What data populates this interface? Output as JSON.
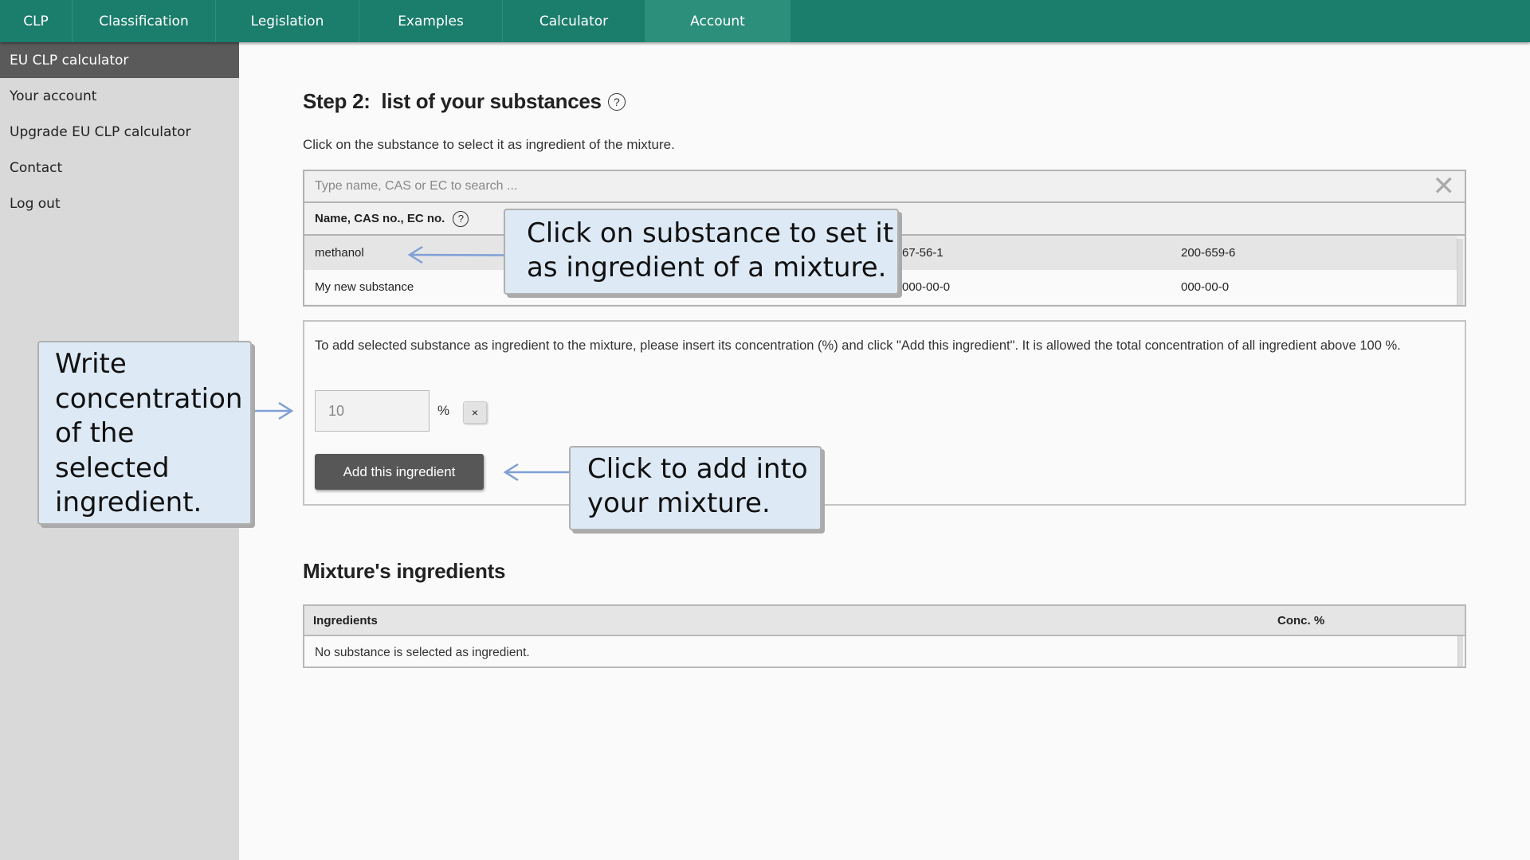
{
  "nav": {
    "items": [
      {
        "label": "CLP",
        "active": false
      },
      {
        "label": "Classification",
        "active": false
      },
      {
        "label": "Legislation",
        "active": false
      },
      {
        "label": "Examples",
        "active": false
      },
      {
        "label": "Calculator",
        "active": false
      },
      {
        "label": "Account",
        "active": true
      }
    ]
  },
  "sidebar": {
    "items": [
      {
        "label": "EU CLP calculator",
        "active": true
      },
      {
        "label": "Your account"
      },
      {
        "label": "Upgrade EU CLP calculator"
      },
      {
        "label": "Contact"
      },
      {
        "label": "Log out"
      }
    ]
  },
  "main": {
    "step_title": "Step 2:  list of your substances",
    "help_glyph": "?",
    "instruction": "Click on the substance to select it as ingredient of the mixture.",
    "search": {
      "placeholder": "Type name, CAS or EC to search ...",
      "value": "",
      "clear_glyph": "✕"
    },
    "substances_table": {
      "header": "Name, CAS no., EC no.",
      "rows": [
        {
          "name": "methanol",
          "cas": "67-56-1",
          "ec": "200-659-6",
          "selected": true
        },
        {
          "name": "My new substance",
          "cas": "000-00-0",
          "ec": "000-00-0",
          "selected": false
        }
      ]
    },
    "concentration": {
      "text": "To add selected substance as ingredient to the mixture, please insert its concentration (%) and click \"Add this ingredient\". It is allowed the total concentration of all ingredient above 100 %.",
      "input_value": "10",
      "unit": "%",
      "clear_glyph": "×",
      "add_button": "Add this ingredient"
    },
    "mixture": {
      "title": "Mixture's ingredients",
      "columns": [
        "Ingredients",
        "Conc. %"
      ],
      "empty_text": "No substance is selected as ingredient."
    }
  },
  "callouts": {
    "select_substance": "Click on substance to set it as ingredient of a mixture.",
    "write_concentration": "Write concentration of the selected ingredient.",
    "add_ingredient": "Click to add into your mixture."
  },
  "colors": {
    "nav_bg": "#1b7d6c",
    "nav_active": "#2c8f7b",
    "sidebar_bg": "#d9d9d9",
    "sidebar_active": "#5a5a5a",
    "callout_bg": "#dde9f5",
    "arrow": "#7f9fd6",
    "button_bg": "#575757"
  }
}
